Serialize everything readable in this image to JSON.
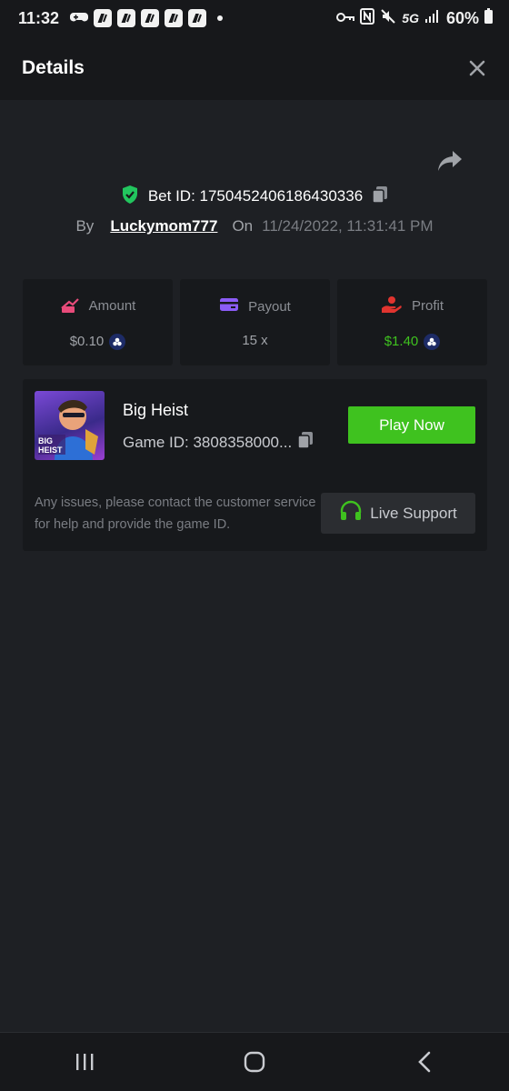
{
  "status_bar": {
    "time": "11:32",
    "battery": "60%",
    "network": "5G"
  },
  "header": {
    "title": "Details"
  },
  "bet": {
    "label": "Bet ID: 1750452406186430336",
    "by_label": "By",
    "username": "Luckymom777",
    "on_label": "On",
    "datetime": "11/24/2022, 11:31:41 PM"
  },
  "stats": {
    "amount": {
      "label": "Amount",
      "value": "$0.10",
      "color": "#a0a3a8"
    },
    "payout": {
      "label": "Payout",
      "value": "15 x",
      "color": "#a0a3a8"
    },
    "profit": {
      "label": "Profit",
      "value": "$1.40",
      "color": "#3fc21f"
    }
  },
  "game": {
    "thumb_text": "BIG HEIST",
    "name": "Big Heist",
    "id_label": "Game ID: 3808358000...",
    "play_label": "Play Now",
    "notice": "Any issues, please contact the customer service for help and provide the game ID.",
    "support_label": "Live Support"
  },
  "colors": {
    "accent_green": "#3fc21f",
    "shield_green": "#22c55e",
    "amount_icon": "#e84b7a",
    "payout_icon": "#8b5cf6",
    "profit_icon": "#e0342f"
  }
}
